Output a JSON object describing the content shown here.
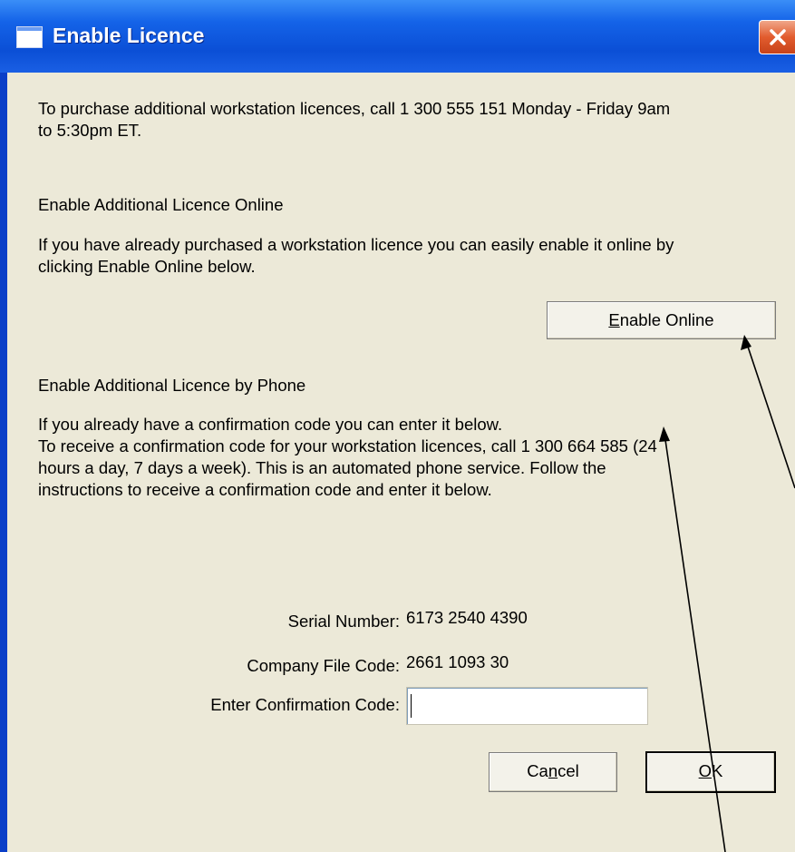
{
  "window": {
    "title": "Enable Licence"
  },
  "intro": {
    "line1": "To purchase additional workstation licences, call 1 300 555 151 Monday - Friday 9am",
    "line2": "to 5:30pm ET."
  },
  "online": {
    "heading": "Enable Additional Licence Online",
    "line1": "If you have already purchased a workstation licence you can easily enable it online by",
    "line2": "clicking Enable Online below.",
    "button": {
      "accel": "E",
      "rest": "nable Online"
    }
  },
  "phone": {
    "heading": "Enable Additional Licence by Phone",
    "line1": "If you already have a confirmation code you can enter it below.",
    "line2": "To receive a confirmation code for your workstation licences, call 1 300 664 585 (24",
    "line3": "hours a day, 7 days a week).  This is an automated phone service.  Follow the",
    "line4": "instructions to receive a confirmation code and enter it below."
  },
  "fields": {
    "serial_label": "Serial Number:",
    "serial_value": "6173 2540 4390",
    "company_label": "Company File Code:",
    "company_value": "2661 1093 30",
    "confirm_label": "Enter Confirmation Code:",
    "confirm_value": ""
  },
  "buttons": {
    "cancel": {
      "pre": "Ca",
      "accel": "n",
      "post": "cel"
    },
    "ok": {
      "accel": "O",
      "post": "K"
    }
  },
  "icons": {
    "title": "window-icon",
    "close": "close-x-icon"
  }
}
